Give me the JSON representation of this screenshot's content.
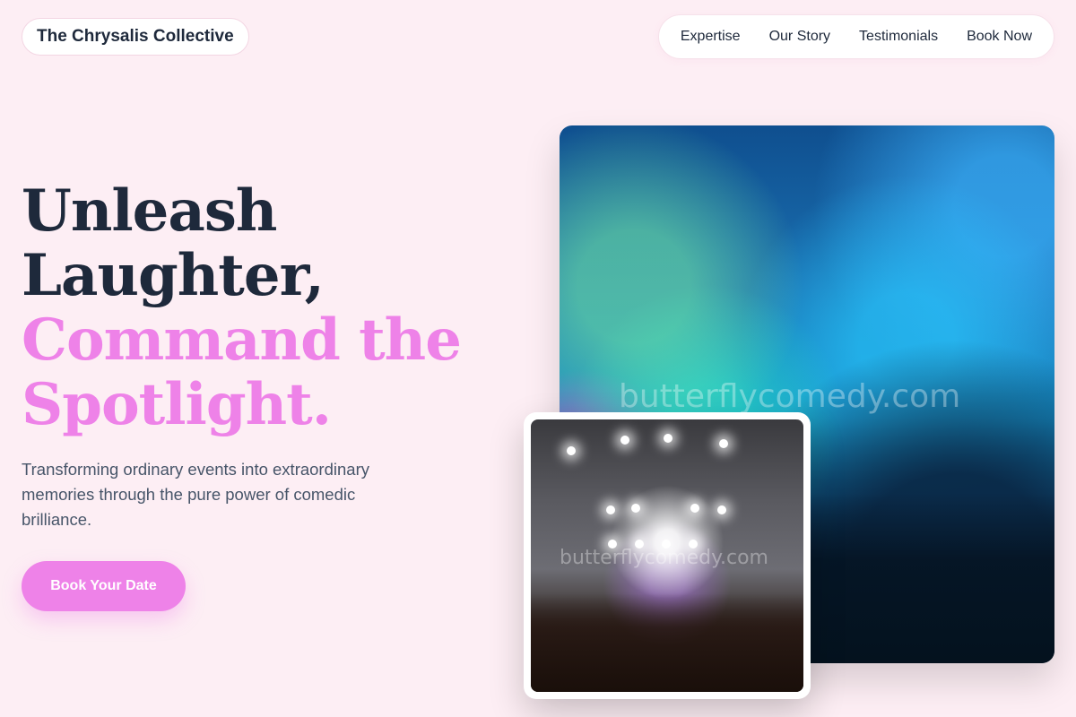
{
  "brand": {
    "name": "The Chrysalis Collective"
  },
  "nav": {
    "items": [
      "Expertise",
      "Our Story",
      "Testimonials",
      "Book Now"
    ]
  },
  "hero": {
    "headline_dark": [
      "Unleash",
      "Laughter,"
    ],
    "headline_pink": [
      "Command the",
      "Spotlight."
    ],
    "subtitle": "Transforming ordinary events into extraordinary memories through the pure power of comedic brilliance.",
    "cta_label": "Book Your Date"
  },
  "images": {
    "large_watermark": "butterflycomedy.com",
    "small_watermark": "butterflycomedy.com"
  },
  "colors": {
    "accent": "#ee82e8",
    "background": "#fdeef4",
    "text": "#1e293b",
    "muted": "#475569"
  }
}
